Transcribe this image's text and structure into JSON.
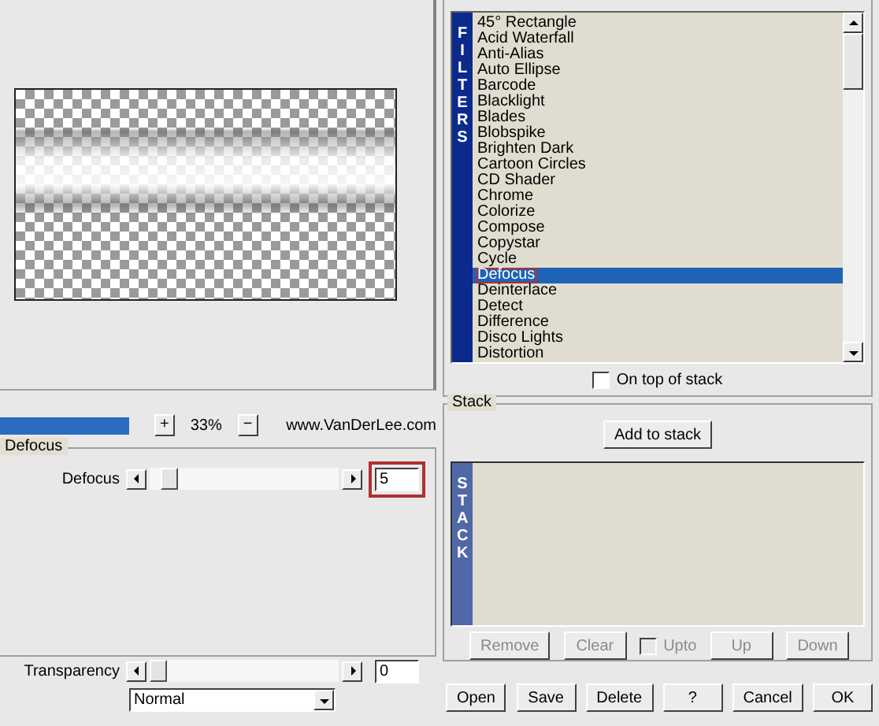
{
  "zoom_bar": {
    "level": 1,
    "zoom_in": "+",
    "value": "33%",
    "zoom_out": "−",
    "website": "www.VanDerLee.com"
  },
  "effect_group": {
    "title": "Defocus",
    "sliders": [
      {
        "label": "Defocus",
        "level": 0.06,
        "value": "5",
        "highlighted": true
      }
    ]
  },
  "transparency": {
    "label": "Transparency",
    "level": 0,
    "value": "0"
  },
  "blend_mode": {
    "value": "Normal"
  },
  "filters": {
    "band": "FILTERS",
    "items": [
      {
        "label": "45° Rectangle",
        "selected": false,
        "highlighted": false
      },
      {
        "label": "Acid Waterfall",
        "selected": false,
        "highlighted": false
      },
      {
        "label": "Anti-Alias",
        "selected": false,
        "highlighted": false
      },
      {
        "label": "Auto Ellipse",
        "selected": false,
        "highlighted": false
      },
      {
        "label": "Barcode",
        "selected": false,
        "highlighted": false
      },
      {
        "label": "Blacklight",
        "selected": false,
        "highlighted": false
      },
      {
        "label": "Blades",
        "selected": false,
        "highlighted": false
      },
      {
        "label": "Blobspike",
        "selected": false,
        "highlighted": false
      },
      {
        "label": "Brighten Dark",
        "selected": false,
        "highlighted": false
      },
      {
        "label": "Cartoon Circles",
        "selected": false,
        "highlighted": false
      },
      {
        "label": "CD Shader",
        "selected": false,
        "highlighted": false
      },
      {
        "label": "Chrome",
        "selected": false,
        "highlighted": false
      },
      {
        "label": "Colorize",
        "selected": false,
        "highlighted": false
      },
      {
        "label": "Compose",
        "selected": false,
        "highlighted": false
      },
      {
        "label": "Copystar",
        "selected": false,
        "highlighted": false
      },
      {
        "label": "Cycle",
        "selected": false,
        "highlighted": false
      },
      {
        "label": "Defocus",
        "selected": true,
        "highlighted": true
      },
      {
        "label": "Deinterlace",
        "selected": false,
        "highlighted": false
      },
      {
        "label": "Detect",
        "selected": false,
        "highlighted": false
      },
      {
        "label": "Difference",
        "selected": false,
        "highlighted": false
      },
      {
        "label": "Disco Lights",
        "selected": false,
        "highlighted": false
      },
      {
        "label": "Distortion",
        "selected": false,
        "highlighted": false
      }
    ],
    "on_top_of_stack": {
      "label": "On top of stack",
      "checked": false
    }
  },
  "stack": {
    "title": "Stack",
    "add_button": "Add to stack",
    "band": "STACK",
    "controls": [
      {
        "kind": "button",
        "label": "Remove",
        "disabled": true
      },
      {
        "kind": "button",
        "label": "Clear",
        "disabled": true
      },
      {
        "kind": "checkbox",
        "label": "Upto",
        "checked": false,
        "disabled": true
      },
      {
        "kind": "button",
        "label": "Up",
        "disabled": true
      },
      {
        "kind": "button",
        "label": "Down",
        "disabled": true
      }
    ]
  },
  "dialog_buttons": [
    "Open",
    "Save",
    "Delete",
    "?",
    "Cancel",
    "OK"
  ]
}
